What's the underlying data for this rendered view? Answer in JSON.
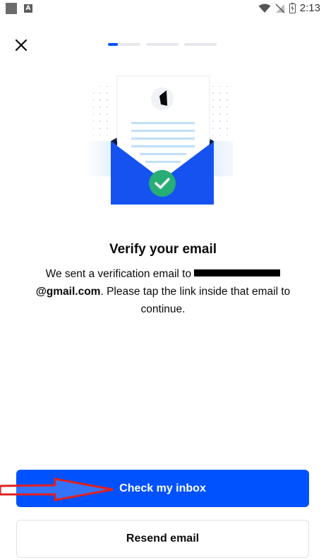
{
  "status_bar": {
    "time": "2:13",
    "app_icon_letter": "A"
  },
  "header": {
    "close_icon": "close-icon",
    "progress": {
      "steps": 3,
      "current_fill_fraction": 0.3
    }
  },
  "illustration": {
    "name": "email-verified-illustration",
    "accent": "#0052ff",
    "check_color": "#27ad75"
  },
  "content": {
    "title": "Verify your email",
    "message_before": "We sent a verification email to ",
    "email_visible_suffix": "@gmail.com",
    "message_after": ". Please tap the link inside that email to continue."
  },
  "actions": {
    "primary_label": "Check my inbox",
    "secondary_label": "Resend email"
  },
  "colors": {
    "primary": "#0052ff",
    "annotation_arrow": "#e02020"
  }
}
